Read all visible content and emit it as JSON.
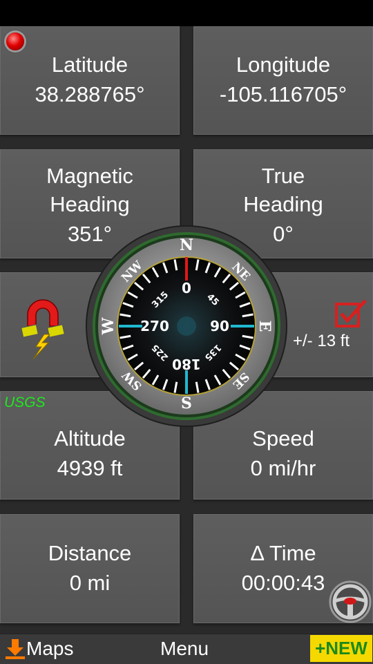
{
  "tiles": {
    "latitude": {
      "label": "Latitude",
      "value": "38.288765°"
    },
    "longitude": {
      "label": "Longitude",
      "value": "-105.116705°"
    },
    "magnetic_heading": {
      "label_line1": "Magnetic",
      "label_line2": "Heading",
      "value": "351°"
    },
    "true_heading": {
      "label_line1": "True",
      "label_line2": "Heading",
      "value": "0°"
    },
    "altitude": {
      "label": "Altitude",
      "value": "4939 ft"
    },
    "speed": {
      "label": "Speed",
      "value": "0 mi/hr"
    },
    "distance": {
      "label": "Distance",
      "value": "0 mi"
    },
    "delta_time": {
      "label": "Δ Time",
      "value": "00:00:43"
    }
  },
  "accuracy": "+/- 13 ft",
  "source_badge": "USGS",
  "compass": {
    "cardinals": {
      "n": "N",
      "ne": "NE",
      "e": "E",
      "se": "SE",
      "s": "S",
      "sw": "SW",
      "w": "W",
      "nw": "NW"
    },
    "degrees": {
      "d0": "0",
      "d45": "45",
      "d90": "90",
      "d135": "135",
      "d180": "180",
      "d225": "225",
      "d270": "270",
      "d315": "315"
    }
  },
  "bottom": {
    "maps": "Maps",
    "menu": "Menu",
    "new": "+NEW"
  },
  "icons": {
    "record": "record-icon",
    "magnet": "magnet-icon",
    "check": "checkbox-icon",
    "download": "download-icon",
    "steering": "steering-wheel-icon"
  },
  "colors": {
    "new_bg": "#f5d800",
    "new_text": "#1b8a1b",
    "usgs": "#1ee81e",
    "check": "#d62020"
  }
}
